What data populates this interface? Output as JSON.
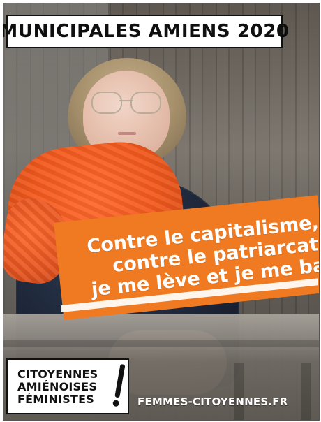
{
  "header": {
    "title": "MUNICIPALES AMIENS 2020"
  },
  "slogan": {
    "lines": [
      "Contre le capitalisme,",
      "contre le patriarcat",
      "je me lève et je me bats"
    ]
  },
  "logo": {
    "lines": [
      "CITOYENNES",
      "AMIÉNOISES",
      "FÉMINISTES"
    ],
    "mark": "!"
  },
  "footer": {
    "website": "FEMMES-CITOYENNES.FR"
  },
  "colors": {
    "accent_orange": "#f07a22",
    "scarf_orange": "#f35a1e",
    "text_dark": "#111111",
    "text_light": "#ffffff"
  },
  "icons": {
    "exclamation": "exclamation-mark-icon"
  }
}
